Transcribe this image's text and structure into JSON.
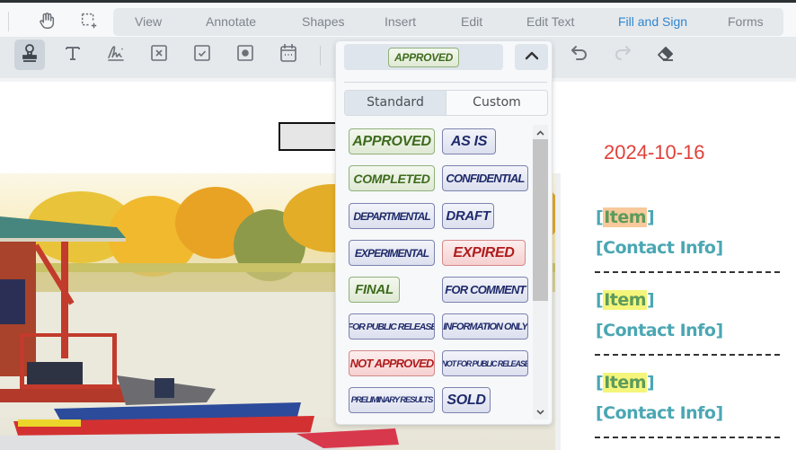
{
  "menu": {
    "items": [
      {
        "label": "View"
      },
      {
        "label": "Annotate"
      },
      {
        "label": "Shapes"
      },
      {
        "label": "Insert"
      },
      {
        "label": "Edit"
      },
      {
        "label": "Edit Text"
      },
      {
        "label": "Fill and Sign",
        "active": true
      },
      {
        "label": "Forms"
      }
    ],
    "active_color": "#2f86cf"
  },
  "top_tools": [
    {
      "icon": "hand-pan-icon"
    },
    {
      "icon": "marquee-select-icon"
    }
  ],
  "fill_sign_tools": [
    {
      "icon": "stamp-icon",
      "active": true
    },
    {
      "icon": "text-icon"
    },
    {
      "icon": "signature-icon"
    },
    {
      "icon": "cross-mark-icon"
    },
    {
      "icon": "checkmark-icon"
    },
    {
      "icon": "dot-icon"
    },
    {
      "icon": "calendar-date-icon"
    }
  ],
  "history_tools": [
    {
      "icon": "undo-icon",
      "enabled": true
    },
    {
      "icon": "redo-icon",
      "enabled": false
    },
    {
      "icon": "eraser-icon",
      "enabled": true
    }
  ],
  "stamp_dropdown": {
    "selected": "APPROVED",
    "tabs": [
      {
        "label": "Standard",
        "active": true
      },
      {
        "label": "Custom",
        "active": false
      }
    ],
    "stamps": [
      {
        "label": "APPROVED",
        "color": "green"
      },
      {
        "label": "AS IS",
        "color": "blue"
      },
      {
        "label": "COMPLETED",
        "color": "green"
      },
      {
        "label": "CONFIDENTIAL",
        "color": "blue"
      },
      {
        "label": "DEPARTMENTAL",
        "color": "blue"
      },
      {
        "label": "DRAFT",
        "color": "blue"
      },
      {
        "label": "EXPERIMENTAL",
        "color": "blue"
      },
      {
        "label": "EXPIRED",
        "color": "red"
      },
      {
        "label": "FINAL",
        "color": "green"
      },
      {
        "label": "FOR COMMENT",
        "color": "blue"
      },
      {
        "label": "FOR PUBLIC RELEASE",
        "color": "blue"
      },
      {
        "label": "INFORMATION ONLY",
        "color": "blue"
      },
      {
        "label": "NOT APPROVED",
        "color": "red"
      },
      {
        "label": "NOT FOR PUBLIC RELEASE",
        "color": "blue"
      },
      {
        "label": "PRELIMINARY RESULTS",
        "color": "blue"
      },
      {
        "label": "SOLD",
        "color": "blue"
      }
    ]
  },
  "document": {
    "date": "2024-10-16",
    "entries": [
      {
        "item_open": "[",
        "item": "Item",
        "item_close": "]",
        "contact": "[Contact Info]",
        "highlight": "#f8c99a"
      },
      {
        "item_open": "[",
        "item": "Item",
        "item_close": "]",
        "contact": "[Contact Info]",
        "highlight": "#f4f57a"
      },
      {
        "item_open": "[",
        "item": "Item",
        "item_close": "]",
        "contact": "[Contact Info]",
        "highlight": "#f4f57a"
      }
    ]
  }
}
